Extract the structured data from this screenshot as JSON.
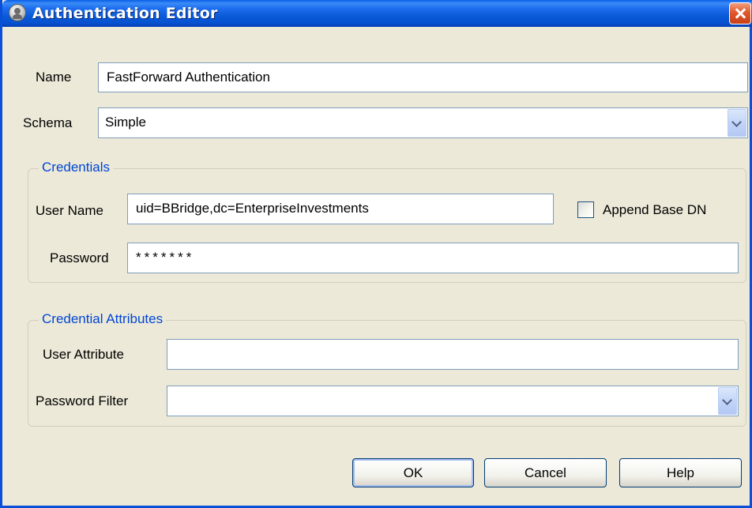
{
  "window": {
    "title": "Authentication Editor"
  },
  "name": {
    "label": "Name",
    "value": "FastForward Authentication"
  },
  "schema": {
    "label": "Schema",
    "selected": "Simple"
  },
  "credentials": {
    "group_title": "Credentials",
    "user_name_label": "User Name",
    "user_name_value": "uid=BBridge,dc=EnterpriseInvestments",
    "append_base_dn_label": "Append Base DN",
    "append_base_dn_checked": false,
    "password_label": "Password",
    "password_value": "*******"
  },
  "credential_attributes": {
    "group_title": "Credential Attributes",
    "user_attribute_label": "User Attribute",
    "user_attribute_value": "",
    "password_filter_label": "Password Filter",
    "password_filter_selected": ""
  },
  "buttons": {
    "ok": "OK",
    "cancel": "Cancel",
    "help": "Help"
  },
  "icons": {
    "title": "user-icon",
    "close": "close-icon",
    "dropdown": "chevron-down-icon"
  },
  "colors": {
    "titlebar": "#0a5ad8",
    "group_title": "#0046d5",
    "close": "#e2582a"
  }
}
